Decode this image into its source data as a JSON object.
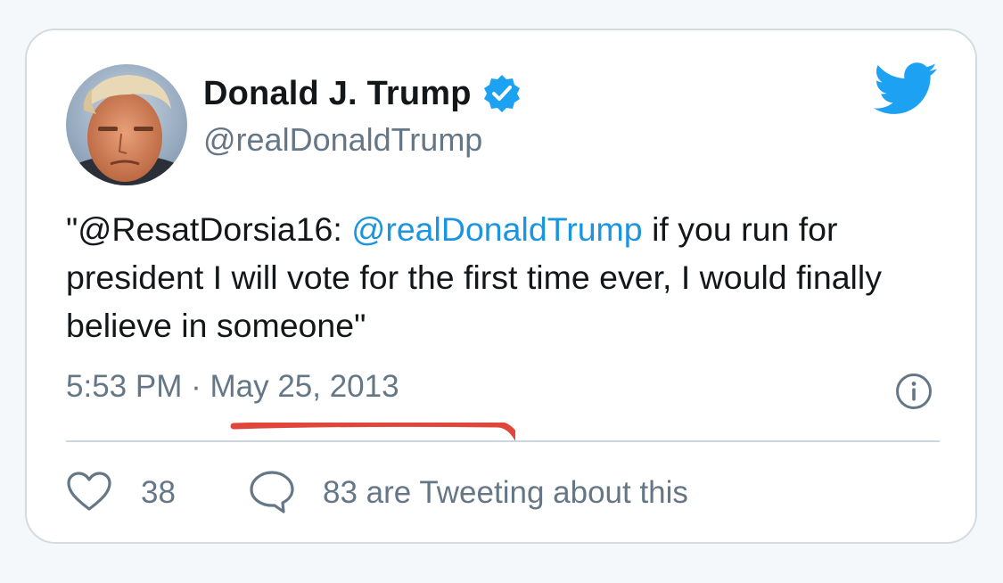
{
  "author": {
    "display_name": "Donald J. Trump",
    "handle": "@realDonaldTrump",
    "avatar_icon": "profile-photo",
    "verified_icon": "verified-badge-icon"
  },
  "tweet": {
    "text_before": "\"@ResatDorsia16: ",
    "mention": "@realDonaldTrump",
    "text_after": " if you run for president I will vote for the first time ever, I would finally believe in someone\""
  },
  "meta": {
    "time": "5:53 PM",
    "separator": " · ",
    "date": "May 25, 2013"
  },
  "actions": {
    "like_count": "38",
    "talking_label": "83 are Tweeting about this"
  },
  "icons": {
    "brand": "twitter-bird-icon",
    "info": "info-icon",
    "like": "heart-icon",
    "reply": "speech-bubble-icon"
  },
  "colors": {
    "brand_blue": "#1da1f2",
    "mention_blue": "#1b95e0",
    "text_primary": "#14171a",
    "text_secondary": "#657786",
    "annotation_red": "#e0473a",
    "border": "#d3dbe0"
  }
}
